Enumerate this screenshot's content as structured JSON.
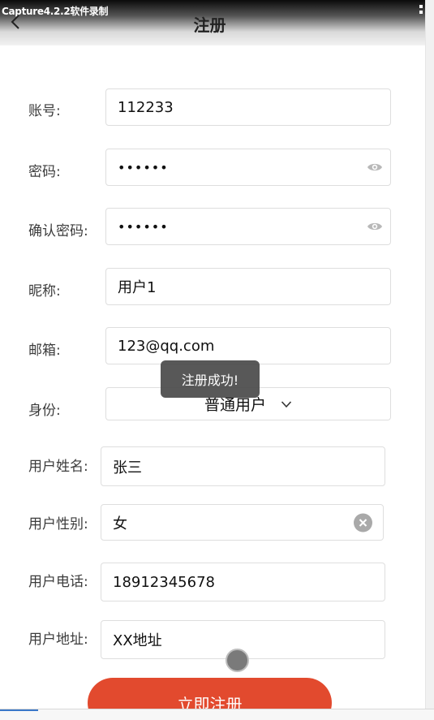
{
  "recorder_label": "Capture4.2.2软件录制",
  "header": {
    "title": "注册"
  },
  "form": {
    "account": {
      "label": "账号:",
      "value": "112233"
    },
    "password": {
      "label": "密码:",
      "value": "••••••"
    },
    "confirm_password": {
      "label": "确认密码:",
      "value": "••••••"
    },
    "nickname": {
      "label": "昵称:",
      "value": "用户1"
    },
    "email": {
      "label": "邮箱:",
      "value": "123@qq.com"
    },
    "identity": {
      "label": "身份:",
      "value": "普通用户"
    },
    "real_name": {
      "label": "用户姓名:",
      "value": "张三"
    },
    "gender": {
      "label": "用户性别:",
      "value": "女"
    },
    "phone": {
      "label": "用户电话:",
      "value": "18912345678"
    },
    "address": {
      "label": "用户地址:",
      "value": "XX地址"
    }
  },
  "toast": {
    "message": "注册成功!"
  },
  "submit": {
    "label": "立即注册"
  },
  "icons": {
    "back": "chevron-left-icon",
    "eye": "eye-icon",
    "clear": "clear-circle-icon",
    "dropdown": "chevron-down-icon"
  },
  "colors": {
    "accent": "#e24a2e",
    "toast_bg": "#4a4a4a",
    "field_border": "#dedede"
  }
}
